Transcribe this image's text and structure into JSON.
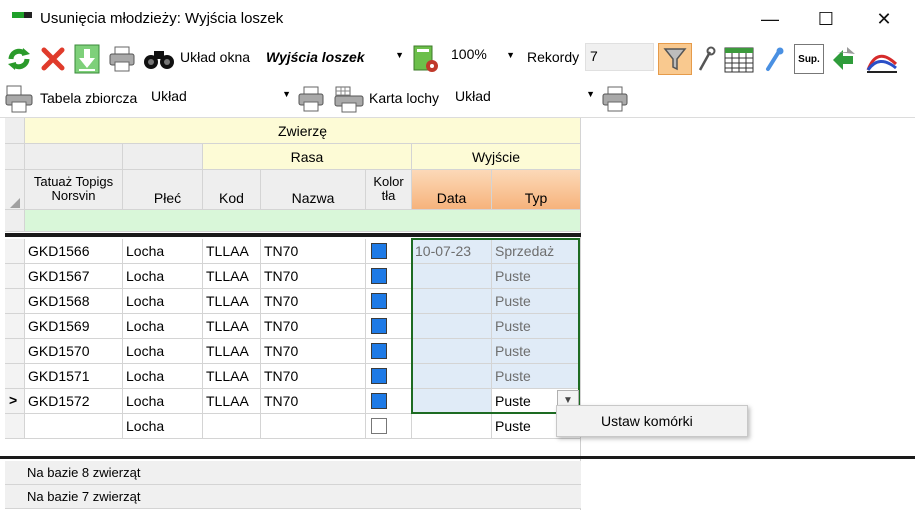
{
  "window": {
    "title": "Usunięcia młodzieży: Wyjścia loszek",
    "minimize_glyph": "—",
    "maximize_glyph": "☐",
    "close_glyph": "✕"
  },
  "toolbar1": {
    "layout_label": "Układ okna",
    "layout_value": "Wyjścia loszek",
    "zoom_value": "100%",
    "records_label": "Rekordy",
    "records_value": "7",
    "icons": [
      "refresh-icon",
      "delete-icon",
      "import-icon",
      "print-icon",
      "binoculars-icon",
      "settings-icon",
      "zoom-dropdown-icon",
      "filter-icon",
      "wrench-icon",
      "calendar-icon",
      "pipette-icon",
      "sup-icon",
      "transfer-icon",
      "curve-icon"
    ],
    "sup_text": "Sup."
  },
  "toolbar2": {
    "summary_label": "Tabela zbiorcza",
    "summary_layout_value": "Układ",
    "sow_card_label": "Karta lochy",
    "sow_card_layout_value": "Układ"
  },
  "grid": {
    "group_header": "Zwierzę",
    "subgroup_breed": "Rasa",
    "subgroup_exit": "Wyjście",
    "columns": {
      "tattoo": "Tatuaż Topigs Norsvin",
      "sex": "Płeć",
      "code": "Kod",
      "name": "Nazwa",
      "bgcolor": "Kolor tła",
      "date": "Data",
      "type": "Typ"
    },
    "rows": [
      {
        "tattoo": "GKD1566",
        "sex": "Locha",
        "code": "TLLAA",
        "name": "TN70",
        "date": "10-07-23",
        "type": "Sprzedaż"
      },
      {
        "tattoo": "GKD1567",
        "sex": "Locha",
        "code": "TLLAA",
        "name": "TN70",
        "date": "",
        "type": "Puste"
      },
      {
        "tattoo": "GKD1568",
        "sex": "Locha",
        "code": "TLLAA",
        "name": "TN70",
        "date": "",
        "type": "Puste"
      },
      {
        "tattoo": "GKD1569",
        "sex": "Locha",
        "code": "TLLAA",
        "name": "TN70",
        "date": "",
        "type": "Puste"
      },
      {
        "tattoo": "GKD1570",
        "sex": "Locha",
        "code": "TLLAA",
        "name": "TN70",
        "date": "",
        "type": "Puste"
      },
      {
        "tattoo": "GKD1571",
        "sex": "Locha",
        "code": "TLLAA",
        "name": "TN70",
        "date": "",
        "type": "Puste"
      },
      {
        "tattoo": "GKD1572",
        "sex": "Locha",
        "code": "TLLAA",
        "name": "TN70",
        "date": "",
        "type": "Puste"
      }
    ],
    "new_row": {
      "sex": "Locha",
      "type": "Puste"
    },
    "current_row_marker": ">",
    "footer": [
      "Na bazie 8 zwierząt",
      "Na bazie 7 zwierząt"
    ],
    "swatch_color": "#1e7ae6"
  },
  "context_menu": {
    "item": "Ustaw komórki"
  },
  "colors": {
    "header_yellow": "#fdfbd6",
    "header_orange": "#f6b37c",
    "filter_green": "#d9f7d9",
    "selection_border": "#1d6b22",
    "selection_fill": "#e0ebf7"
  }
}
